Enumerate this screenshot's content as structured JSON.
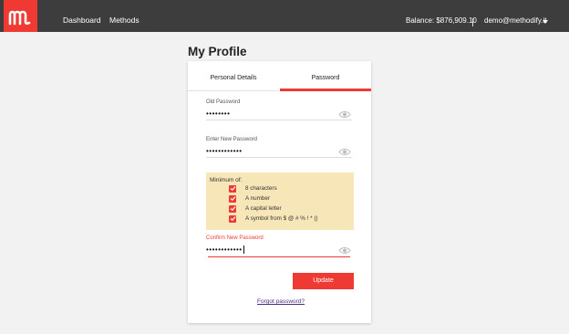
{
  "brand": {
    "logo_letter": "m",
    "color": "#ee3a33"
  },
  "topbar": {
    "nav": [
      {
        "label": "Dashboard"
      },
      {
        "label": "Methods"
      }
    ],
    "balance": "Balance: $876,909.10",
    "user_email": "demo@methodify.it",
    "user_menu_icon": "chevron-down-icon"
  },
  "page": {
    "title": "My Profile"
  },
  "tabs": [
    {
      "label": "Personal Details",
      "active": false
    },
    {
      "label": "Password",
      "active": true
    }
  ],
  "form": {
    "old_password": {
      "label": "Old Password",
      "value": "••••••••",
      "icon": "eye-icon"
    },
    "new_password": {
      "label": "Enter New Password",
      "value": "••••••••••••",
      "icon": "eye-icon"
    },
    "requirements": {
      "title": "Minimum of:",
      "items": [
        {
          "label": "8 characters",
          "checked": true
        },
        {
          "label": "A number",
          "checked": true
        },
        {
          "label": "A capital letter",
          "checked": true
        },
        {
          "label": "A symbol from $ @ # % ! * ()",
          "checked": true
        }
      ]
    },
    "confirm_password": {
      "label": "Confirm New Password",
      "value": "••••••••••••",
      "icon": "eye-icon"
    },
    "update_label": "Update",
    "forgot_label": "Forgot password?"
  },
  "colors": {
    "accent": "#ee3a33",
    "topbar": "#3d3d3d",
    "requirements_bg": "#f7e7b8",
    "link": "#4b2e83"
  }
}
